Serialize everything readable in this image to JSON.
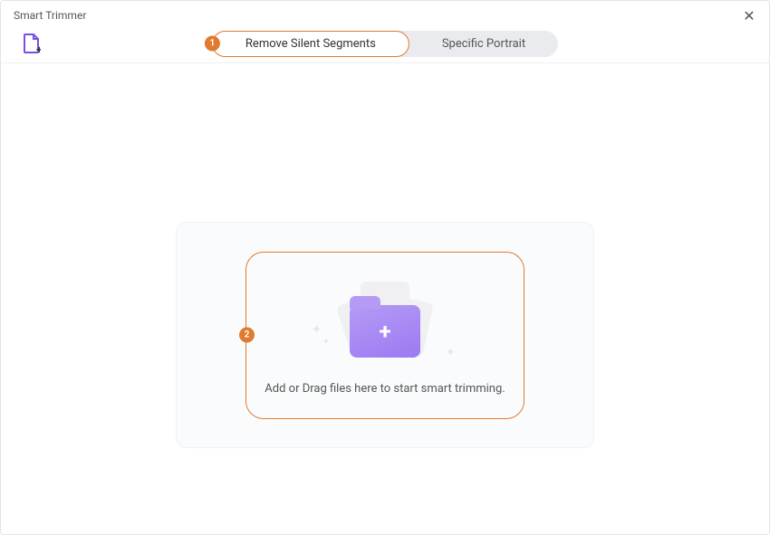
{
  "window": {
    "title": "Smart Trimmer"
  },
  "tabs": {
    "remove_silent": "Remove Silent Segments",
    "specific_portrait": "Specific Portrait"
  },
  "badges": {
    "step1": "1",
    "step2": "2"
  },
  "dropzone": {
    "instruction": "Add or Drag files here to start smart trimming."
  },
  "icons": {
    "folder_plus": "+"
  }
}
